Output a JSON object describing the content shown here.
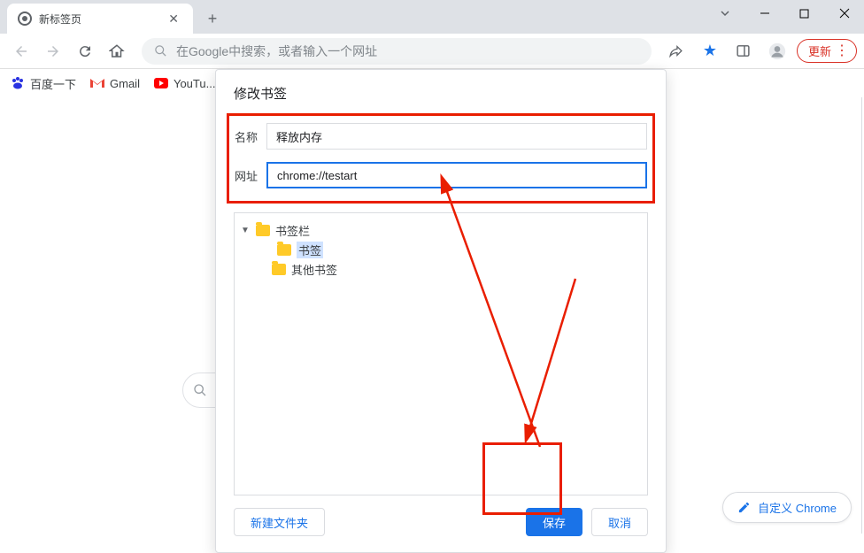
{
  "tab": {
    "title": "新标签页"
  },
  "omnibox": {
    "placeholder": "在Google中搜索，或者输入一个网址"
  },
  "toolbar": {
    "update_label": "更新"
  },
  "bookmarks_bar": {
    "items": [
      {
        "label": "百度一下"
      },
      {
        "label": "Gmail"
      },
      {
        "label": "YouTu..."
      }
    ]
  },
  "dialog": {
    "title": "修改书签",
    "name_label": "名称",
    "name_value": "释放内存",
    "url_label": "网址",
    "url_value": "chrome://testart",
    "tree": {
      "root": "书签栏",
      "child": "书签",
      "other": "其他书签"
    },
    "new_folder": "新建文件夹",
    "save": "保存",
    "cancel": "取消"
  },
  "customize": {
    "label": "自定义 Chrome"
  }
}
